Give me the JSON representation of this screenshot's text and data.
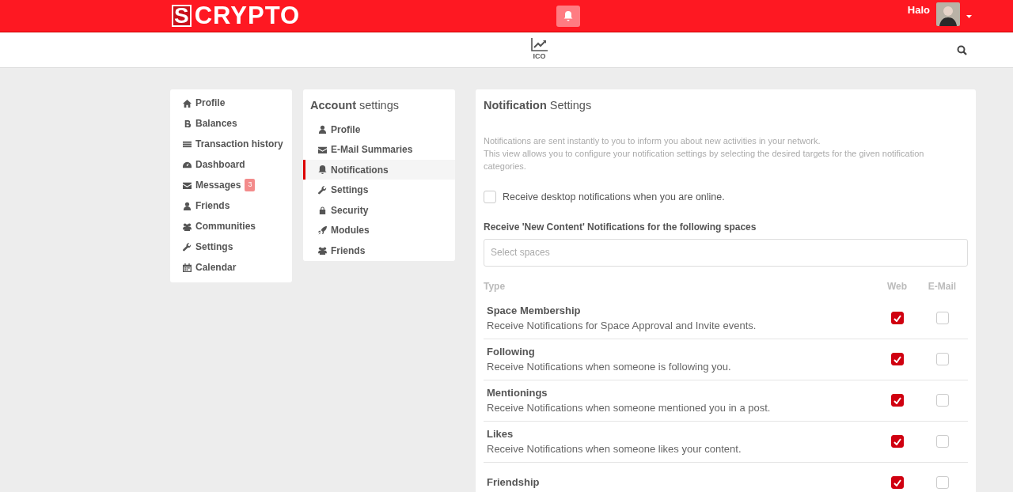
{
  "topbar": {
    "logo_letter": "S",
    "logo_text": "CRYPTO",
    "user_name": "Halo"
  },
  "subnav": {
    "items": [
      {
        "label": "ICO"
      }
    ]
  },
  "main_menu": [
    {
      "label": "Profile"
    },
    {
      "label": "Balances"
    },
    {
      "label": "Transaction history"
    },
    {
      "label": "Dashboard"
    },
    {
      "label": "Messages",
      "badge": "3"
    },
    {
      "label": "Friends"
    },
    {
      "label": "Communities"
    },
    {
      "label": "Settings"
    },
    {
      "label": "Calendar"
    }
  ],
  "account_settings": {
    "title_bold": "Account",
    "title_rest": "settings",
    "items": [
      {
        "label": "Profile",
        "selected": false
      },
      {
        "label": "E-Mail Summaries",
        "selected": false
      },
      {
        "label": "Notifications",
        "selected": true
      },
      {
        "label": "Settings",
        "selected": false
      },
      {
        "label": "Security",
        "selected": false
      },
      {
        "label": "Modules",
        "selected": false
      },
      {
        "label": "Friends",
        "selected": false
      }
    ]
  },
  "notification_settings": {
    "title_bold": "Notification",
    "title_rest": "Settings",
    "intro": [
      "Notifications are sent instantly to you to inform you about new activities in your network.",
      "This view allows you to configure your notification settings by selecting the desired targets for the given notification categories."
    ],
    "desktop": {
      "label": "Receive desktop notifications when you are online.",
      "checked": false
    },
    "spaces_label": "Receive 'New Content' Notifications for the following spaces",
    "spaces_field": {
      "placeholder": "Select spaces"
    },
    "columns": [
      "Type",
      "Web",
      "E-Mail"
    ],
    "rows": [
      {
        "title": "Space Membership",
        "description": "Receive Notifications for Space Approval and Invite events.",
        "web": true,
        "email": false
      },
      {
        "title": "Following",
        "description": "Receive Notifications when someone is following you.",
        "web": true,
        "email": false
      },
      {
        "title": "Mentionings",
        "description": "Receive Notifications when someone mentioned you in a post.",
        "web": true,
        "email": false
      },
      {
        "title": "Likes",
        "description": "Receive Notifications when someone likes your content.",
        "web": true,
        "email": false
      },
      {
        "title": "Friendship",
        "web": true,
        "email": false
      }
    ]
  }
}
